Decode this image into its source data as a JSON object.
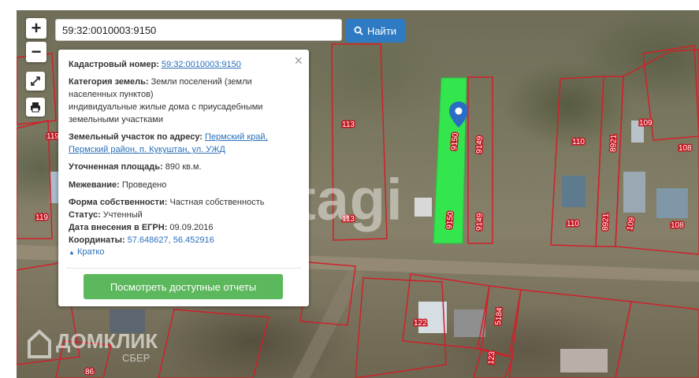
{
  "search": {
    "value": "59:32:0010003:9150",
    "button_label": "Найти"
  },
  "map_controls": {
    "zoom_in": "+",
    "zoom_out": "−"
  },
  "popup": {
    "close": "×",
    "cadastral_label": "Кадастровый номер:",
    "cadastral_value": "59:32:0010003:9150",
    "category_label": "Категория земель:",
    "category_value_1": "Земли поселений (земли",
    "category_value_2": "населенных пунктов)",
    "category_value_3": "индивидуальные жилые дома с приусадебными",
    "category_value_4": "земельными участками",
    "address_label": "Земельный участок по адресу:",
    "address_value_1": "Пермский край,",
    "address_value_2": "Пермский район, п. Кукуштан, ул. УЖД",
    "area_label": "Уточненная площадь:",
    "area_value": "890 кв.м.",
    "survey_label": "Межевание:",
    "survey_value": "Проведено",
    "ownership_label": "Форма собственности:",
    "ownership_value": "Частная собственность",
    "status_label": "Статус:",
    "status_value": "Учтенный",
    "date_label": "Дата внесения в ЕГРН:",
    "date_value": "09.09.2016",
    "coords_label": "Координаты:",
    "coords_value": "57.648627, 56.452916",
    "collapse_link": "Кратко",
    "report_button": "Посмотреть доступные отчеты"
  },
  "map_labels": {
    "parcel_113a": "113",
    "parcel_113b": "113",
    "parcel_119a": "119",
    "parcel_119b": "119",
    "parcel_9150a": "9150",
    "parcel_9150b": "9150",
    "parcel_9149a": "9149",
    "parcel_9149b": "9149",
    "parcel_110a": "110",
    "parcel_110b": "110",
    "parcel_8921a": "8921",
    "parcel_8921b": "8921",
    "parcel_109a": "109",
    "parcel_109b": "109",
    "parcel_108a": "108",
    "parcel_108b": "108",
    "parcel_122": "122",
    "parcel_5184": "5184",
    "parcel_123": "123",
    "parcel_86": "86"
  },
  "watermark": "tagi",
  "brand": {
    "name": "ДОМКЛИК",
    "sub": "СБЕР"
  },
  "colors": {
    "selected_parcel": "#33e64d",
    "parcel_border": "#d0202a",
    "accent": "#2e7bc4",
    "report_button": "#5cb85c"
  }
}
